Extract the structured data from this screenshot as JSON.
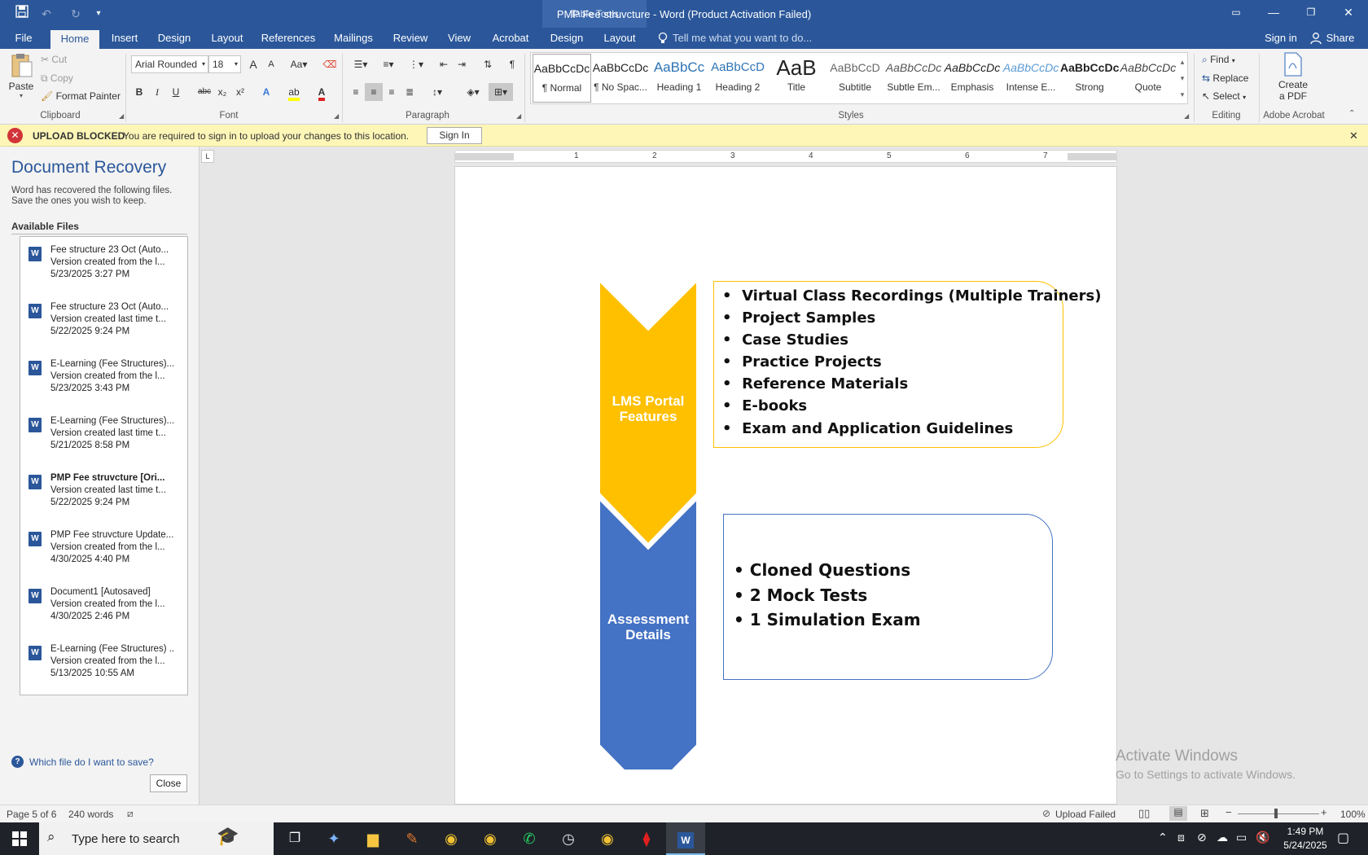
{
  "titlebar": {
    "title": "PMP Fee struvcture - Word (Product Activation Failed)",
    "context_tab": "Table Tools",
    "save_icon": "save-icon",
    "undo_icon": "undo-icon",
    "redo_icon": "redo-icon",
    "customize_icon": "customize-qat-icon",
    "ribbon_options_icon": "ribbon-display-options-icon",
    "minimize_icon": "minimize-icon",
    "restore_icon": "restore-icon",
    "close_icon": "close-icon"
  },
  "tabs": {
    "file": "File",
    "home": "Home",
    "insert": "Insert",
    "design": "Design",
    "layout": "Layout",
    "references": "References",
    "mailings": "Mailings",
    "review": "Review",
    "view": "View",
    "acrobat": "Acrobat",
    "table_design": "Design",
    "table_layout": "Layout",
    "tell_me": "Tell me what you want to do...",
    "sign_in": "Sign in",
    "share": "Share"
  },
  "ribbon": {
    "clipboard": {
      "paste": "Paste",
      "cut": "Cut",
      "copy": "Copy",
      "format_painter": "Format Painter",
      "label": "Clipboard"
    },
    "font": {
      "family": "Arial Rounded",
      "size": "18",
      "label": "Font",
      "bold": "B",
      "italic": "I",
      "underline": "U",
      "strikethrough": "abc",
      "subscript": "x₂",
      "superscript": "x²",
      "grow": "A",
      "shrink": "A",
      "case": "Aa"
    },
    "paragraph": {
      "label": "Paragraph",
      "pilcrow": "¶"
    },
    "styles": {
      "label": "Styles",
      "items": [
        {
          "preview": "AaBbCcDc",
          "name": "¶ Normal"
        },
        {
          "preview": "AaBbCcDc",
          "name": "¶ No Spac..."
        },
        {
          "preview": "AaBbCc",
          "name": "Heading 1"
        },
        {
          "preview": "AaBbCcD",
          "name": "Heading 2"
        },
        {
          "preview": "AaB",
          "name": "Title"
        },
        {
          "preview": "AaBbCcD",
          "name": "Subtitle"
        },
        {
          "preview": "AaBbCcDc",
          "name": "Subtle Em..."
        },
        {
          "preview": "AaBbCcDc",
          "name": "Emphasis"
        },
        {
          "preview": "AaBbCcDc",
          "name": "Intense E..."
        },
        {
          "preview": "AaBbCcDc",
          "name": "Strong"
        },
        {
          "preview": "AaBbCcDc",
          "name": "Quote"
        }
      ]
    },
    "editing": {
      "find": "Find",
      "replace": "Replace",
      "select": "Select",
      "label": "Editing"
    },
    "acrobat": {
      "create_line1": "Create",
      "create_line2": "a PDF",
      "label": "Adobe Acrobat"
    }
  },
  "infobar": {
    "title": "UPLOAD BLOCKED",
    "message": "You are required to sign in to upload your changes to this location.",
    "button": "Sign In"
  },
  "recovery": {
    "title": "Document Recovery",
    "desc1": "Word has recovered the following files.",
    "desc2": "Save the ones you wish to keep.",
    "available": "Available Files",
    "help": "Which file do I want to save?",
    "close": "Close",
    "files": [
      {
        "name": "Fee structure 23 Oct (Auto...",
        "desc": "Version created from the l...",
        "date": "5/23/2025 3:27 PM",
        "bold": false
      },
      {
        "name": "Fee structure 23 Oct (Auto...",
        "desc": "Version created last time t...",
        "date": "5/22/2025 9:24 PM",
        "bold": false
      },
      {
        "name": "E-Learning (Fee Structures)...",
        "desc": "Version created from the l...",
        "date": "5/23/2025 3:43 PM",
        "bold": false
      },
      {
        "name": "E-Learning (Fee Structures)...",
        "desc": "Version created last time t...",
        "date": "5/21/2025 8:58 PM",
        "bold": false
      },
      {
        "name": "PMP Fee struvcture  [Ori...",
        "desc": "Version created last time t...",
        "date": "5/22/2025 9:24 PM",
        "bold": true
      },
      {
        "name": "PMP Fee struvcture Update...",
        "desc": "Version created from the l...",
        "date": "4/30/2025 4:40 PM",
        "bold": false
      },
      {
        "name": "Document1  [Autosaved]",
        "desc": "Version created from the l...",
        "date": "4/30/2025 2:46 PM",
        "bold": false
      },
      {
        "name": "E-Learning (Fee Structures) ..",
        "desc": "Version created from the l...",
        "date": "5/13/2025 10:55 AM",
        "bold": false
      }
    ]
  },
  "ruler": {
    "marks": [
      "1",
      "2",
      "3",
      "4",
      "5",
      "6",
      "7"
    ]
  },
  "document": {
    "chevron1": {
      "line1": "LMS Portal",
      "line2": "Features",
      "color": "#ffc000"
    },
    "chevron2": {
      "line1": "Assessment",
      "line2": "Details",
      "color": "#4472c4"
    },
    "box1_items": [
      "Virtual Class Recordings (Multiple Trainers)",
      "Project Samples",
      "Case Studies",
      "Practice Projects",
      "Reference Materials",
      "E-books",
      "Exam and Application Guidelines"
    ],
    "box2_items": [
      "Cloned Questions",
      "2 Mock Tests",
      "1  Simulation Exam"
    ],
    "bullet": "•"
  },
  "watermark": {
    "line1": "Activate Windows",
    "line2": "Go to Settings to activate Windows."
  },
  "statusbar": {
    "page": "Page 5 of 6",
    "words": "240 words",
    "upload": "Upload Failed",
    "zoom": "100%"
  },
  "taskbar": {
    "search_placeholder": "Type here to search",
    "time": "1:49 PM",
    "date": "5/24/2025"
  }
}
